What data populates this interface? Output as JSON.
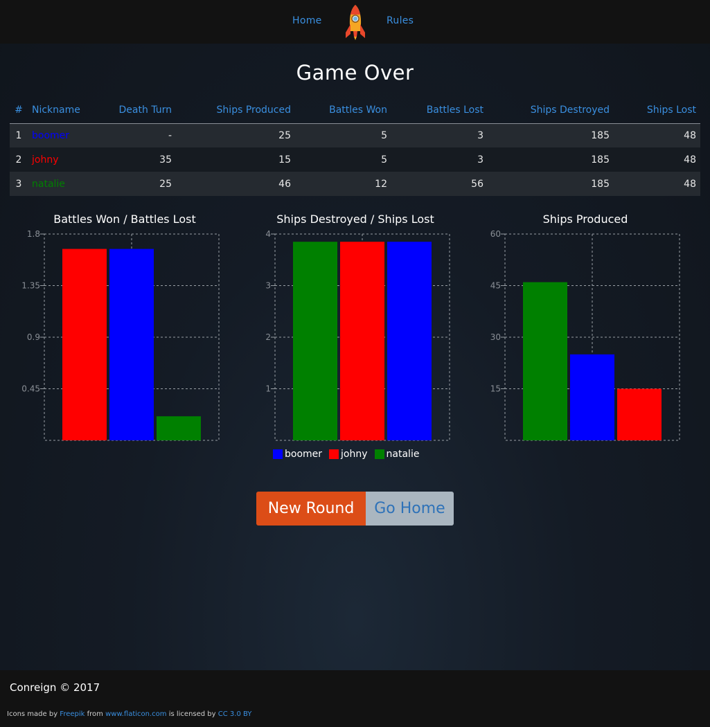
{
  "nav": {
    "home": "Home",
    "rules": "Rules"
  },
  "logo": {
    "icon": "rocket-icon"
  },
  "title": "Game Over",
  "table": {
    "headers": [
      "#",
      "Nickname",
      "Death Turn",
      "Ships Produced",
      "Battles Won",
      "Battles Lost",
      "Ships Destroyed",
      "Ships Lost"
    ],
    "rows": [
      {
        "rank": "1",
        "nickname": "boomer",
        "color": "#0000ff",
        "death_turn": "-",
        "ships_produced": "25",
        "battles_won": "5",
        "battles_lost": "3",
        "ships_destroyed": "185",
        "ships_lost": "48"
      },
      {
        "rank": "2",
        "nickname": "johny",
        "color": "#ff0000",
        "death_turn": "35",
        "ships_produced": "15",
        "battles_won": "5",
        "battles_lost": "3",
        "ships_destroyed": "185",
        "ships_lost": "48"
      },
      {
        "rank": "3",
        "nickname": "natalie",
        "color": "#008000",
        "death_turn": "25",
        "ships_produced": "46",
        "battles_won": "12",
        "battles_lost": "56",
        "ships_destroyed": "185",
        "ships_lost": "48"
      }
    ]
  },
  "chart_data": [
    {
      "type": "bar",
      "title": "Battles Won / Battles Lost",
      "categories": [
        "johny",
        "boomer",
        "natalie"
      ],
      "values": [
        1.67,
        1.67,
        0.21
      ],
      "colors": [
        "#ff0000",
        "#0000ff",
        "#008000"
      ],
      "yticks": [
        "1.8",
        "1.35",
        "0.9",
        "0.45"
      ],
      "ylim": [
        0,
        1.8
      ],
      "grid": true
    },
    {
      "type": "bar",
      "title": "Ships Destroyed / Ships Lost",
      "categories": [
        "natalie",
        "johny",
        "boomer"
      ],
      "values": [
        3.85,
        3.85,
        3.85
      ],
      "colors": [
        "#008000",
        "#ff0000",
        "#0000ff"
      ],
      "yticks": [
        "4",
        "3",
        "2",
        "1"
      ],
      "ylim": [
        0,
        4
      ],
      "grid": true
    },
    {
      "type": "bar",
      "title": "Ships Produced",
      "categories": [
        "natalie",
        "boomer",
        "johny"
      ],
      "values": [
        46,
        25,
        15
      ],
      "colors": [
        "#008000",
        "#0000ff",
        "#ff0000"
      ],
      "yticks": [
        "60",
        "45",
        "30",
        "15"
      ],
      "ylim": [
        0,
        60
      ],
      "grid": true
    }
  ],
  "legend": [
    {
      "label": "boomer",
      "color": "#0000ff"
    },
    {
      "label": "johny",
      "color": "#ff0000"
    },
    {
      "label": "natalie",
      "color": "#008000"
    }
  ],
  "buttons": {
    "new_round": "New Round",
    "go_home": "Go Home"
  },
  "footer": {
    "copyright": "Conreign © 2017",
    "credits_prefix": "Icons made by",
    "credits_author": "Freepik",
    "credits_from": "from",
    "credits_site": "www.flaticon.com",
    "credits_licensed": "is licensed by",
    "credits_license": "CC 3.0 BY"
  }
}
